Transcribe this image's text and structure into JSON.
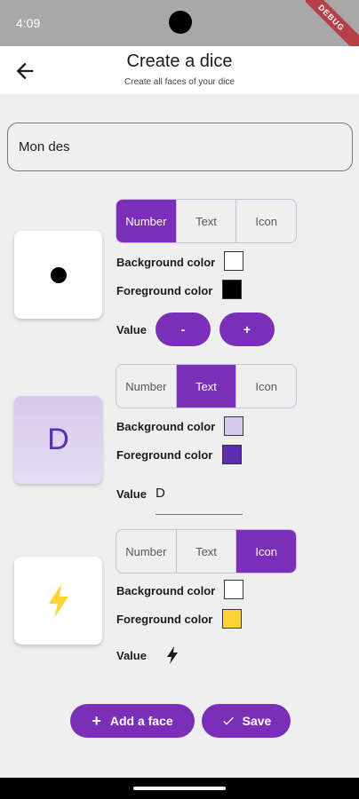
{
  "status_bar": {
    "time": "4:09",
    "debug_label": "DEBUG"
  },
  "app_bar": {
    "title": "Create a dice",
    "subtitle": "Create all faces of your dice"
  },
  "name_input": {
    "value": "Mon des"
  },
  "faces": [
    {
      "tabs": [
        "Number",
        "Text",
        "Icon"
      ],
      "selected": "Number",
      "background_label": "Background color",
      "foreground_label": "Foreground color",
      "background_color": "#ffffff",
      "foreground_color": "#000000",
      "value_label": "Value",
      "minus_label": "-",
      "plus_label": "+",
      "value": 1
    },
    {
      "tabs": [
        "Number",
        "Text",
        "Icon"
      ],
      "selected": "Text",
      "background_label": "Background color",
      "foreground_label": "Foreground color",
      "background_color": "#d7caec",
      "foreground_color": "#5a2fb0",
      "value_label": "Value",
      "value": "D"
    },
    {
      "tabs": [
        "Number",
        "Text",
        "Icon"
      ],
      "selected": "Icon",
      "background_label": "Background color",
      "foreground_label": "Foreground color",
      "background_color": "#ffffff",
      "foreground_color": "#fcd535",
      "value_label": "Value",
      "icon": "lightning-bolt-icon"
    }
  ],
  "actions": {
    "add_face_label": "Add a face",
    "save_label": "Save"
  },
  "colors": {
    "accent": "#7b2fb8"
  }
}
